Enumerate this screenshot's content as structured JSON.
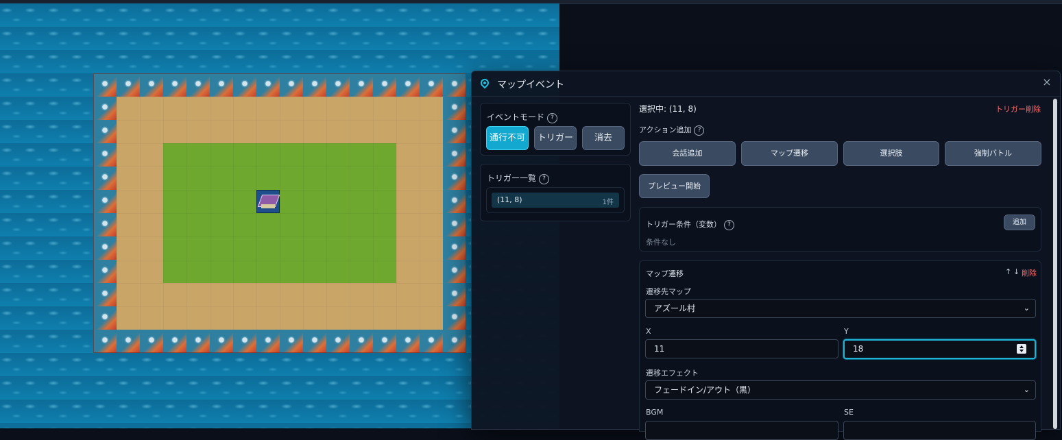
{
  "dialog": {
    "title": "マップイベント",
    "close_glyph": "×"
  },
  "event_mode": {
    "label": "イベントモード",
    "help": "?",
    "buttons": [
      "通行不可",
      "トリガー",
      "消去"
    ],
    "active": "通行不可"
  },
  "trigger_list": {
    "label": "トリガー一覧",
    "help": "?",
    "items": [
      {
        "coord": "(11, 8)",
        "count": "1件"
      }
    ]
  },
  "selection": {
    "text": "選択中: (11, 8)",
    "delete_trigger": "トリガー削除"
  },
  "action_add": {
    "label": "アクション追加",
    "help": "?",
    "buttons": [
      "会話追加",
      "マップ遷移",
      "選択肢",
      "強制バトル"
    ],
    "preview": "プレビュー開始"
  },
  "trigger_condition": {
    "label": "トリガー条件（変数）",
    "help": "?",
    "add": "追加",
    "empty": "条件なし"
  },
  "map_transition": {
    "label": "マップ遷移",
    "up": "↑",
    "down": "↓",
    "delete": "削除",
    "dest_label": "遷移先マップ",
    "dest_value": "アズール村",
    "x_label": "X",
    "x_value": "11",
    "y_label": "Y",
    "y_value": "18",
    "effect_label": "遷移エフェクト",
    "effect_value": "フェードイン/アウト（黒）",
    "bgm_label": "BGM",
    "se_label": "SE"
  },
  "colors": {
    "accent": "#13a8cf",
    "danger": "#ff6b6b",
    "panel": "#0b111c"
  }
}
